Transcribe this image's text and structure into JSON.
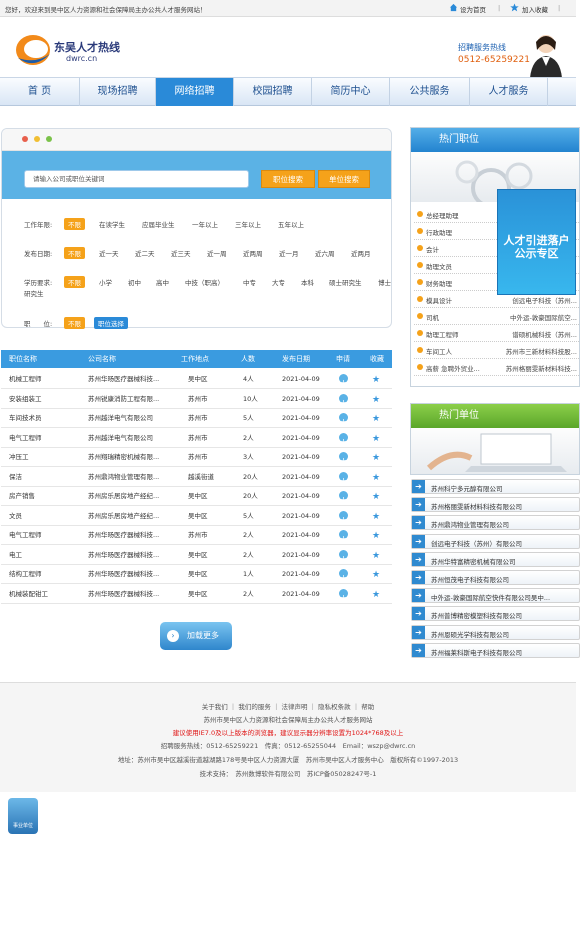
{
  "topbar": {
    "welcome": "您好，欢迎来到吴中区人力资源和社会保障局主办公共人才服务网站！",
    "set_home": "设为首页",
    "favorite": "加入收藏",
    "sep": "|"
  },
  "brand": {
    "name_cn": "东吴人才热线",
    "domain": "dwrc.cn"
  },
  "hotline": {
    "label": "招聘服务热线",
    "number": "0512-65259221"
  },
  "nav": {
    "items": [
      "首 页",
      "现场招聘",
      "网络招聘",
      "校园招聘",
      "简历中心",
      "公共服务",
      "人才服务"
    ],
    "active": "网络招聘"
  },
  "search": {
    "placeholder": "请输入公司或职位关键词",
    "btn_job": "职位搜索",
    "btn_company": "单位搜索"
  },
  "filters": {
    "exp_label": "工作年限:",
    "exp_options": [
      "不限",
      "在读学生",
      "应届毕业生",
      "一年以上",
      "三年以上",
      "五年以上"
    ],
    "date_label": "发布日期:",
    "date_options": [
      "不限",
      "近一天",
      "近二天",
      "近三天",
      "近一周",
      "近两周",
      "近一月",
      "近六周",
      "近两月"
    ],
    "edu_label": "学历要求:",
    "edu_options": [
      "不限",
      "小学",
      "初中",
      "高中",
      "中技（职高）",
      "中专",
      "大专",
      "本科",
      "硕士研究生",
      "博士",
      "研究生"
    ],
    "pos_label": "职　　位:",
    "pos_any": "不限",
    "pos_select": "职位选择"
  },
  "table": {
    "headers": [
      "职位名称",
      "公司名称",
      "工作地点",
      "人数",
      "发布日期",
      "申请",
      "收藏"
    ],
    "rows": [
      [
        "机械工程师",
        "苏州华旸医疗器械科技...",
        "吴中区",
        "4人",
        "2021-04-09"
      ],
      [
        "安装组装工",
        "苏州锐康消防工程有限...",
        "苏州市",
        "10人",
        "2021-04-09"
      ],
      [
        "车间技术员",
        "苏州越洋电气有限公司",
        "苏州市",
        "5人",
        "2021-04-09"
      ],
      [
        "电气工程师",
        "苏州越洋电气有限公司",
        "苏州市",
        "2人",
        "2021-04-09"
      ],
      [
        "冲压工",
        "苏州翔瑞精密机械有限...",
        "苏州市",
        "3人",
        "2021-04-09"
      ],
      [
        "保洁",
        "苏州鼎鸿物业管理有限...",
        "越溪街道",
        "20人",
        "2021-04-09"
      ],
      [
        "房产销售",
        "苏州房乐居房地产经纪...",
        "吴中区",
        "20人",
        "2021-04-09"
      ],
      [
        "文员",
        "苏州房乐居房地产经纪...",
        "吴中区",
        "5人",
        "2021-04-09"
      ],
      [
        "电气工程师",
        "苏州华旸医疗器械科技...",
        "苏州市",
        "2人",
        "2021-04-09"
      ],
      [
        "电工",
        "苏州华旸医疗器械科技...",
        "吴中区",
        "2人",
        "2021-04-09"
      ],
      [
        "结构工程师",
        "苏州华旸医疗器械科技...",
        "吴中区",
        "1人",
        "2021-04-09"
      ],
      [
        "机械装配钳工",
        "苏州华旸医疗器械科技...",
        "吴中区",
        "2人",
        "2021-04-09"
      ]
    ],
    "apply_icon": "plus-circle-icon",
    "fav_icon": "star-icon"
  },
  "load_more": "加载更多",
  "hot_jobs": {
    "title": "热门职位",
    "items": [
      {
        "job": "总经理助理",
        "company": ""
      },
      {
        "job": "行政助理",
        "company": ""
      },
      {
        "job": "会计",
        "company": ""
      },
      {
        "job": "助理文员",
        "company": ""
      },
      {
        "job": "财务助理",
        "company": ""
      },
      {
        "job": "模具设计",
        "company": "创远电子科技（苏州..."
      },
      {
        "job": "司机",
        "company": "中外运-敦豪国际航空..."
      },
      {
        "job": "助理工程师",
        "company": "谱硕机械科技（苏州..."
      },
      {
        "job": "车间工人",
        "company": "苏州市三新材料科技股..."
      },
      {
        "job": "高薪 急聘外贸业...",
        "company": "苏州格丽雯新材料科技..."
      }
    ]
  },
  "promo": {
    "line1": "人才引进落户",
    "line2": "公示专区"
  },
  "hot_units": {
    "title": "热门单位",
    "items": [
      "苏州科宁多元醇有限公司",
      "苏州格丽雯新材料科技有限公司",
      "苏州鼎鸿物业管理有限公司",
      "创远电子科技（苏州）有限公司",
      "苏州华特富精密机械有限公司",
      "苏州恒茂电子科技有限公司",
      "中外运-敦豪国际航空快件有限公司吴中...",
      "苏州普博精密模塑科技有限公司",
      "苏州恩硕光学科技有限公司",
      "苏州福莱科斯电子科技有限公司"
    ]
  },
  "footer": {
    "links": [
      "关于我们",
      "我们的服务",
      "法律声明",
      "隐私权条款",
      "帮助"
    ],
    "org": "苏州市吴中区人力资源和社会保障局主办公共人才服务网站",
    "browser_tip": "建议使用IE7.0及以上版本的浏览器，建议显示器分辨率设置为1024*768及以上",
    "contact": "招聘服务热线：0512-65259221　传真：0512-65255044　Email：wszp@dwrc.cn",
    "address": "地址：苏州市吴中区越溪街道越湖路178号吴中区人力资源大厦　苏州市吴中区人才服务中心　版权所有©1997-2013",
    "support": "技术支持：　苏州数博软件有限公司　苏ICP备05028247号-1"
  },
  "badge": {
    "text": "事业单位"
  },
  "colors": {
    "primary": "#2a8ad8",
    "accent": "#f5a21a",
    "warning": "#e01414"
  }
}
